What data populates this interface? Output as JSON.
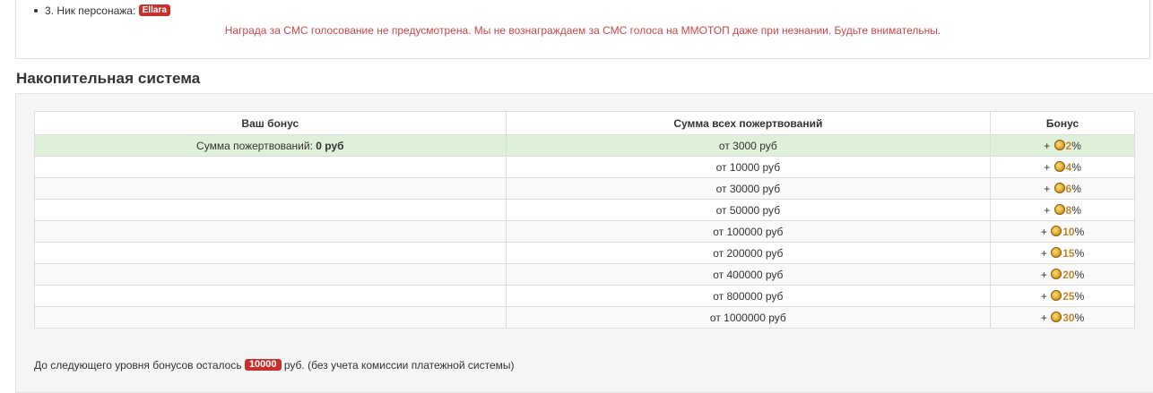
{
  "top": {
    "nick_label": "3. Ник персонажа:",
    "nick_value": "Ellara",
    "warning": "Награда за СМС голосование не предусмотрена. Мы не вознаграждаем за СМС голоса на ММОТОП даже при незнании. Будьте внимательны."
  },
  "accumulative": {
    "title": "Накопительная система",
    "headers": [
      "Ваш бонус",
      "Сумма всех пожертвований",
      "Бонус"
    ],
    "your_bonus_label": "Сумма пожертвований:",
    "your_bonus_value": "0 руб",
    "rows": [
      {
        "amount": "от 3000 руб",
        "plus": "+",
        "value": "2",
        "pct": "%"
      },
      {
        "amount": "от 10000 руб",
        "plus": "+",
        "value": "4",
        "pct": "%"
      },
      {
        "amount": "от 30000 руб",
        "plus": "+",
        "value": "6",
        "pct": "%"
      },
      {
        "amount": "от 50000 руб",
        "plus": "+",
        "value": "8",
        "pct": "%"
      },
      {
        "amount": "от 100000 руб",
        "plus": "+",
        "value": "10",
        "pct": "%"
      },
      {
        "amount": "от 200000 руб",
        "plus": "+",
        "value": "15",
        "pct": "%"
      },
      {
        "amount": "от 400000 руб",
        "plus": "+",
        "value": "20",
        "pct": "%"
      },
      {
        "amount": "от 800000 руб",
        "plus": "+",
        "value": "25",
        "pct": "%"
      },
      {
        "amount": "от 1000000 руб",
        "plus": "+",
        "value": "30",
        "pct": "%"
      }
    ],
    "footer_prefix": "До следующего уровня бонусов осталось",
    "footer_badge": "10000",
    "footer_suffix": "руб. (без учета комиссии платежной системы)",
    "coin_icon": "gold-coin-icon"
  }
}
